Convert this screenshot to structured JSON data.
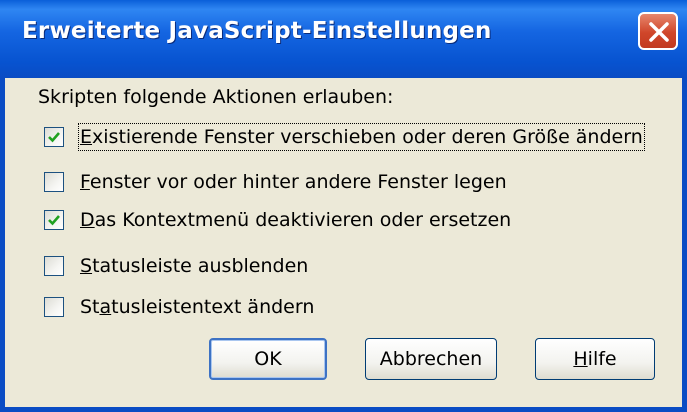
{
  "window": {
    "title": "Erweiterte JavaScript-Einstellungen",
    "close_icon": "close-icon",
    "accent_color": "#0a4cc4",
    "close_color": "#d0462a"
  },
  "prompt": "Skripten folgende Aktionen erlauben:",
  "options": [
    {
      "mnemonic": "E",
      "rest": "xistierende Fenster verschieben oder deren Größe ändern",
      "pre": "",
      "checked": true
    },
    {
      "mnemonic": "F",
      "rest": "enster vor oder hinter andere Fenster legen",
      "pre": "",
      "checked": false
    },
    {
      "mnemonic": "D",
      "rest": "as Kontextmenü deaktivieren oder ersetzen",
      "pre": "",
      "checked": true
    },
    {
      "mnemonic": "S",
      "rest": "tatusleiste ausblenden",
      "pre": "",
      "checked": false
    },
    {
      "pre": "St",
      "mnemonic": "a",
      "rest": "tusleistentext ändern",
      "checked": false
    }
  ],
  "buttons": {
    "ok": "OK",
    "cancel": "Abbrechen",
    "help_mnemonic": "H",
    "help_rest": "ilfe"
  }
}
